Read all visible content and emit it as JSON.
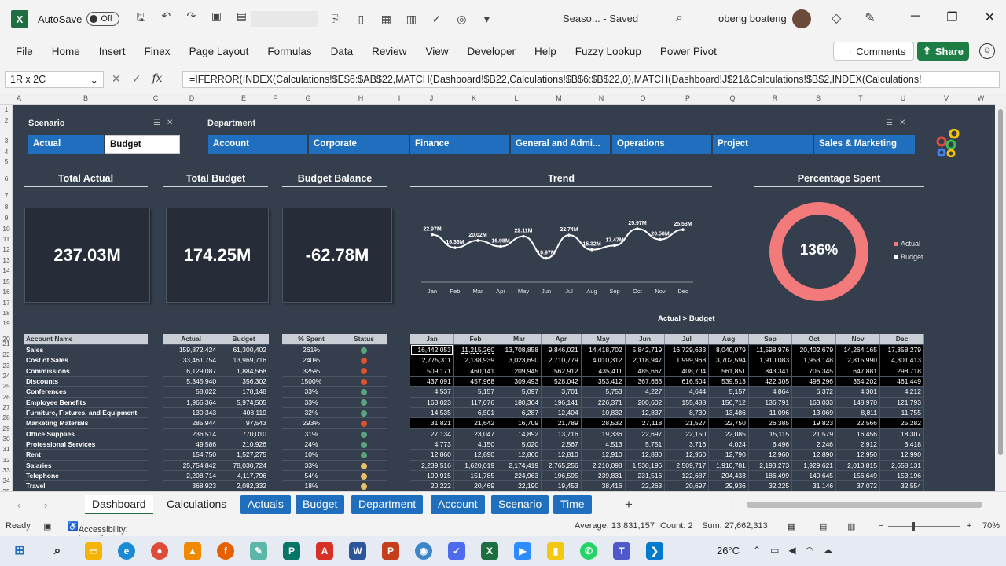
{
  "window": {
    "autosave_label": "AutoSave",
    "autosave_state": "Off",
    "doc_title": "Seaso... - Saved",
    "user_name": "obeng boateng"
  },
  "ribbon": {
    "tabs": [
      "File",
      "Home",
      "Insert",
      "Finex",
      "Page Layout",
      "Formulas",
      "Data",
      "Review",
      "View",
      "Developer",
      "Help",
      "Fuzzy Lookup",
      "Power Pivot"
    ],
    "comments_label": "Comments",
    "share_label": "Share"
  },
  "formula_bar": {
    "name_box": "1R x 2C",
    "formula": "=IFERROR(INDEX(Calculations!$E$6:$AB$22,MATCH(Dashboard!$B22,Calculations!$B$6:$B$22,0),MATCH(Dashboard!J$21&Calculations!$B$2,INDEX(Calculations!"
  },
  "grid": {
    "columns": [
      "A",
      "B",
      "C",
      "D",
      "E",
      "F",
      "G",
      "H",
      "I",
      "J",
      "K",
      "L",
      "M",
      "N",
      "O",
      "P",
      "Q",
      "R",
      "S",
      "T",
      "U",
      "V",
      "W"
    ],
    "rows": [
      "1",
      "2",
      "3",
      "4",
      "5",
      "6",
      "7",
      "8",
      "9",
      "10",
      "11",
      "12",
      "13",
      "14",
      "15",
      "16",
      "17",
      "18",
      "19",
      "20",
      "21",
      "22",
      "23",
      "24",
      "25",
      "26",
      "27",
      "28",
      "29",
      "30",
      "31",
      "32",
      "33",
      "34",
      "35"
    ]
  },
  "slicers": {
    "scenario": {
      "title": "Scenario",
      "items": [
        "Actual",
        "Budget"
      ],
      "selected": "Budget"
    },
    "department": {
      "title": "Department",
      "items": [
        "Account",
        "Corporate",
        "Finance",
        "General and Admi...",
        "Operations",
        "Project",
        "Sales & Marketing"
      ]
    }
  },
  "kpis": {
    "total_actual": {
      "title": "Total Actual",
      "value": "237.03M"
    },
    "total_budget": {
      "title": "Total Budget",
      "value": "174.25M"
    },
    "budget_balance": {
      "title": "Budget Balance",
      "value": "-62.78M"
    }
  },
  "trend": {
    "title": "Trend",
    "months": [
      "Jan",
      "Feb",
      "Mar",
      "Apr",
      "May",
      "Jun",
      "Jul",
      "Aug",
      "Sep",
      "Oct",
      "Nov",
      "Dec"
    ],
    "labels": [
      "22.97M",
      "16.36M",
      "20.02M",
      "16.98M",
      "22.11M",
      "10.97M",
      "22.74M",
      "15.32M",
      "17.47M",
      "25.97M",
      "20.58M",
      "25.53M"
    ]
  },
  "chart_data": [
    {
      "type": "line",
      "title": "Trend",
      "categories": [
        "Jan",
        "Feb",
        "Mar",
        "Apr",
        "May",
        "Jun",
        "Jul",
        "Aug",
        "Sep",
        "Oct",
        "Nov",
        "Dec"
      ],
      "values": [
        22.97,
        16.36,
        20.02,
        16.98,
        22.11,
        10.97,
        22.74,
        15.32,
        17.47,
        25.97,
        20.58,
        25.53
      ],
      "value_labels": [
        "22.97M",
        "16.36M",
        "20.02M",
        "16.98M",
        "22.11M",
        "10.97M",
        "22.74M",
        "15.32M",
        "17.47M",
        "25.97M",
        "20.58M",
        "25.53M"
      ]
    },
    {
      "type": "pie",
      "title": "Percentage Spent",
      "center_label": "136%",
      "legend": [
        "Actual",
        "Budget"
      ],
      "legend_position": "right",
      "colors": {
        "Actual": "#f27a7a",
        "Budget": "#ffffff"
      }
    }
  ],
  "percent_spent": {
    "title": "Percentage Spent",
    "value": "136%",
    "legend": [
      "Actual",
      "Budget"
    ]
  },
  "table": {
    "headers": {
      "account": "Account Name",
      "actual": "Actual",
      "budget": "Budget",
      "pct": "% Spent",
      "status": "Status"
    },
    "rows": [
      {
        "name": "Sales",
        "actual": "159,872,424",
        "budget": "61,300,402",
        "pct": "261%",
        "status": "#5aa37d"
      },
      {
        "name": "Cost of Sales",
        "actual": "33,461,754",
        "budget": "13,969,716",
        "pct": "240%",
        "status": "#d9532c"
      },
      {
        "name": "Commissions",
        "actual": "6,129,087",
        "budget": "1,884,568",
        "pct": "325%",
        "status": "#d9532c"
      },
      {
        "name": "Discounts",
        "actual": "5,345,940",
        "budget": "356,302",
        "pct": "1500%",
        "status": "#d9532c"
      },
      {
        "name": "Conferences",
        "actual": "58,022",
        "budget": "178,148",
        "pct": "33%",
        "status": "#5aa37d"
      },
      {
        "name": "Employee Benefits",
        "actual": "1,966,364",
        "budget": "5,974,505",
        "pct": "33%",
        "status": "#5aa37d"
      },
      {
        "name": "Furniture, Fixtures, and Equipment",
        "actual": "130,343",
        "budget": "408,119",
        "pct": "32%",
        "status": "#5aa37d"
      },
      {
        "name": "Marketing Materials",
        "actual": "285,944",
        "budget": "97,543",
        "pct": "293%",
        "status": "#d9532c"
      },
      {
        "name": "Office Supplies",
        "actual": "236,514",
        "budget": "770,010",
        "pct": "31%",
        "status": "#5aa37d"
      },
      {
        "name": "Professional Services",
        "actual": "49,586",
        "budget": "210,926",
        "pct": "24%",
        "status": "#5aa37d"
      },
      {
        "name": "Rent",
        "actual": "154,750",
        "budget": "1,527,275",
        "pct": "10%",
        "status": "#5aa37d"
      },
      {
        "name": "Salaries",
        "actual": "25,754,842",
        "budget": "78,030,724",
        "pct": "33%",
        "status": "#e8c06a"
      },
      {
        "name": "Telephone",
        "actual": "2,208,714",
        "budget": "4,117,796",
        "pct": "54%",
        "status": "#e8c06a"
      },
      {
        "name": "Travel",
        "actual": "368,923",
        "budget": "2,082,332",
        "pct": "18%",
        "status": "#e8c06a"
      }
    ]
  },
  "monthly": {
    "caption": "Actual > Budget",
    "headers": [
      "Jan",
      "Feb",
      "Mar",
      "Apr",
      "May",
      "Jun",
      "Jul",
      "Aug",
      "Sep",
      "Oct",
      "Nov",
      "Dec"
    ],
    "rows": [
      {
        "hl": true,
        "v": [
          "16,442,053",
          "11,215,260",
          "13,708,858",
          "9,846,021",
          "14,418,702",
          "5,842,719",
          "16,729,633",
          "8,040,079",
          "11,598,976",
          "20,402,679",
          "14,264,165",
          "17,358,279"
        ]
      },
      {
        "hl": true,
        "v": [
          "2,775,311",
          "2,138,939",
          "3,023,690",
          "2,710,779",
          "4,010,312",
          "2,118,947",
          "1,999,968",
          "3,702,594",
          "1,910,083",
          "1,953,148",
          "2,815,990",
          "4,301,413"
        ]
      },
      {
        "hl": true,
        "v": [
          "509,171",
          "460,141",
          "209,945",
          "562,912",
          "435,411",
          "485,667",
          "408,704",
          "561,851",
          "843,341",
          "705,345",
          "647,881",
          "298,718"
        ]
      },
      {
        "hl": true,
        "v": [
          "437,091",
          "457,968",
          "309,493",
          "528,042",
          "353,412",
          "367,663",
          "616,504",
          "539,513",
          "422,305",
          "498,296",
          "354,202",
          "461,449"
        ]
      },
      {
        "hl": false,
        "v": [
          "4,537",
          "5,157",
          "5,097",
          "3,701",
          "5,753",
          "4,227",
          "4,644",
          "5,157",
          "4,864",
          "6,372",
          "4,301",
          "4,212"
        ]
      },
      {
        "hl": false,
        "v": [
          "163,023",
          "117,076",
          "180,364",
          "196,141",
          "226,371",
          "200,602",
          "155,488",
          "156,712",
          "136,791",
          "163,033",
          "148,970",
          "121,793"
        ]
      },
      {
        "hl": false,
        "v": [
          "14,535",
          "6,501",
          "6,287",
          "12,404",
          "10,832",
          "12,837",
          "8,730",
          "13,486",
          "11,096",
          "13,069",
          "8,811",
          "11,755"
        ]
      },
      {
        "hl": true,
        "v": [
          "31,821",
          "21,642",
          "16,709",
          "21,789",
          "28,532",
          "27,118",
          "21,527",
          "22,750",
          "26,385",
          "19,823",
          "22,566",
          "25,282"
        ]
      },
      {
        "hl": false,
        "v": [
          "27,134",
          "23,047",
          "14,892",
          "13,716",
          "19,336",
          "22,697",
          "22,150",
          "22,085",
          "15,115",
          "21,579",
          "16,456",
          "18,307"
        ]
      },
      {
        "hl": false,
        "v": [
          "4,773",
          "4,150",
          "5,020",
          "2,567",
          "4,513",
          "5,751",
          "3,716",
          "4,024",
          "6,496",
          "2,246",
          "2,912",
          "3,418"
        ]
      },
      {
        "hl": false,
        "v": [
          "12,860",
          "12,890",
          "12,860",
          "12,810",
          "12,910",
          "12,880",
          "12,960",
          "12,790",
          "12,960",
          "12,890",
          "12,950",
          "12,990"
        ]
      },
      {
        "hl": false,
        "v": [
          "2,239,516",
          "1,620,019",
          "2,174,419",
          "2,765,256",
          "2,210,098",
          "1,530,196",
          "2,509,717",
          "1,910,781",
          "2,193,273",
          "1,929,621",
          "2,013,815",
          "2,658,131"
        ]
      },
      {
        "hl": false,
        "v": [
          "199,915",
          "151,785",
          "224,963",
          "196,595",
          "239,831",
          "231,516",
          "122,687",
          "204,433",
          "186,499",
          "140,645",
          "156,649",
          "153,196"
        ]
      },
      {
        "hl": false,
        "v": [
          "20,222",
          "20,469",
          "22,190",
          "19,453",
          "38,416",
          "22,263",
          "20,697",
          "29,936",
          "32,225",
          "31,146",
          "37,072",
          "32,554"
        ]
      }
    ]
  },
  "sheet_tabs": [
    {
      "label": "Dashboard",
      "style": "active"
    },
    {
      "label": "Calculations",
      "style": "plain"
    },
    {
      "label": "Actuals",
      "style": "blue"
    },
    {
      "label": "Budget",
      "style": "blue"
    },
    {
      "label": "Department",
      "style": "blue"
    },
    {
      "label": "Account",
      "style": "blue"
    },
    {
      "label": "Scenario",
      "style": "blue"
    },
    {
      "label": "Time",
      "style": "blue"
    }
  ],
  "status_bar": {
    "ready": "Ready",
    "accessibility": "Accessibility: Investigate",
    "average": "Average: 13,831,157",
    "count": "Count: 2",
    "sum": "Sum: 27,662,313",
    "zoom": "70%"
  },
  "taskbar": {
    "temperature": "26°C"
  }
}
